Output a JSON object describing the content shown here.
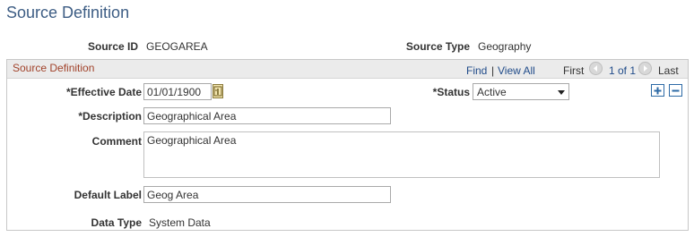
{
  "page": {
    "title": "Source Definition"
  },
  "header": {
    "source_id_label": "Source ID",
    "source_id_value": "GEOGAREA",
    "source_type_label": "Source Type",
    "source_type_value": "Geography"
  },
  "group": {
    "title": "Source Definition",
    "nav": {
      "find": "Find",
      "separator": "|",
      "view_all": "View All",
      "first": "First",
      "page_count": "1 of 1",
      "last": "Last"
    }
  },
  "form": {
    "effective_date_label": "*Effective Date",
    "effective_date_value": "01/01/1900",
    "status_label": "*Status",
    "status_value": "Active",
    "description_label": "*Description",
    "description_value": "Geographical Area",
    "comment_label": "Comment",
    "comment_value": "Geographical Area",
    "default_label_label": "Default Label",
    "default_label_value": "Geog Area",
    "data_type_label": "Data Type",
    "data_type_value": "System Data"
  },
  "icons": {
    "calendar": "calendar-icon",
    "add_row": "plus-icon",
    "delete_row": "minus-icon",
    "prev": "arrow-left-icon",
    "next": "arrow-right-icon"
  },
  "colors": {
    "title": "#3d5d84",
    "group_title": "#a1422a",
    "link": "#214c8a",
    "button_border": "#2d6aa6"
  }
}
